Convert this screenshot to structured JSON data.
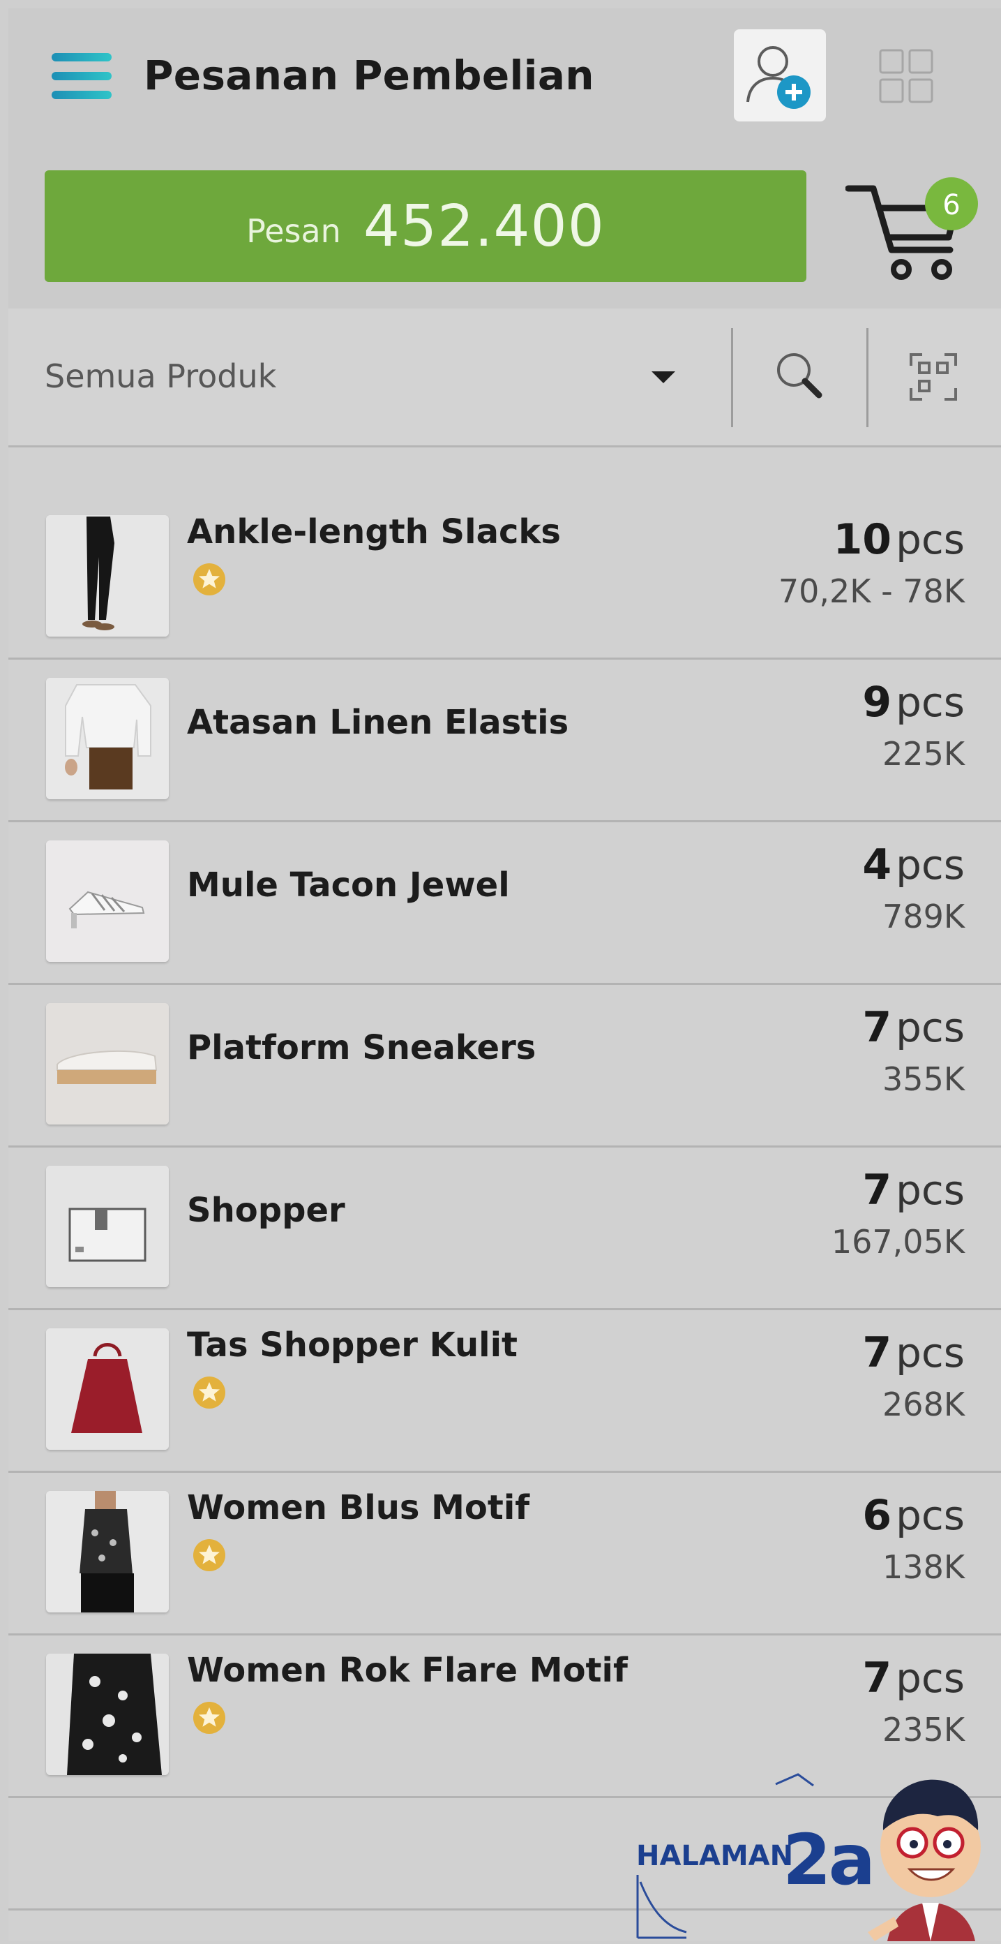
{
  "header": {
    "title": "Pesanan Pembelian",
    "order_label": "Pesan",
    "order_total": "452.400",
    "cart_count": "6"
  },
  "filter": {
    "selected": "Semua Produk"
  },
  "products": [
    {
      "name": "Ankle-length Slacks",
      "starred": true,
      "qty": "10",
      "unit": "pcs",
      "price": "70,2K - 78K"
    },
    {
      "name": "Atasan Linen Elastis",
      "starred": false,
      "qty": "9",
      "unit": "pcs",
      "price": "225K"
    },
    {
      "name": "Mule Tacon Jewel",
      "starred": false,
      "qty": "4",
      "unit": "pcs",
      "price": "789K"
    },
    {
      "name": "Platform Sneakers",
      "starred": false,
      "qty": "7",
      "unit": "pcs",
      "price": "355K"
    },
    {
      "name": "Shopper",
      "starred": false,
      "qty": "7",
      "unit": "pcs",
      "price": "167,05K"
    },
    {
      "name": "Tas Shopper Kulit",
      "starred": true,
      "qty": "7",
      "unit": "pcs",
      "price": "268K"
    },
    {
      "name": "Women Blus Motif",
      "starred": true,
      "qty": "6",
      "unit": "pcs",
      "price": "138K"
    },
    {
      "name": "Women Rok Flare Motif",
      "starred": true,
      "qty": "7",
      "unit": "pcs",
      "price": "235K"
    }
  ],
  "watermark": {
    "label": "HALAMAN",
    "page": "2a"
  },
  "colors": {
    "accent_green": "#6ea83c",
    "badge_green": "#79b83e",
    "star_gold": "#e3b13c",
    "menu_teal": "#1d8fb5"
  }
}
